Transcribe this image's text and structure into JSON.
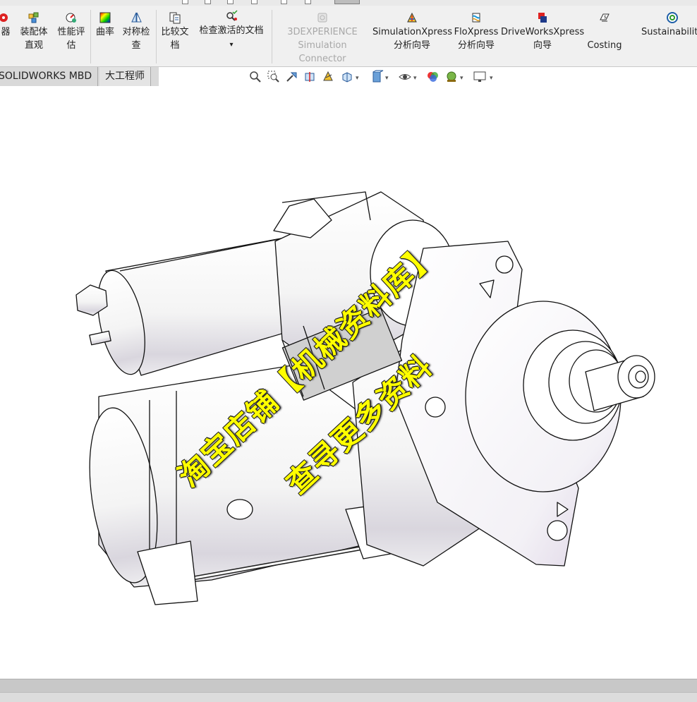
{
  "ribbon": {
    "tools": [
      {
        "id": "partial-left",
        "label": "器",
        "icon": "partial-tool-icon"
      },
      {
        "id": "assembly-visualization",
        "label_l1": "装配体",
        "label_l2": "直观",
        "icon": "assembly-visualization-icon"
      },
      {
        "id": "performance-evaluation",
        "label_l1": "性能评",
        "label_l2": "估",
        "icon": "performance-evaluation-icon"
      },
      {
        "id": "curvature",
        "label_l1": "曲率",
        "label_l2": "",
        "icon": "curvature-icon"
      },
      {
        "id": "symmetry-check",
        "label_l1": "对称检",
        "label_l2": "查",
        "icon": "symmetry-check-icon"
      },
      {
        "id": "compare-documents",
        "label_l1": "比较文",
        "label_l2": "档",
        "icon": "compare-documents-icon"
      },
      {
        "id": "check-active-document",
        "label_l1": "检查激活的文档",
        "label_l2": "▾",
        "icon": "check-active-document-icon"
      },
      {
        "id": "simulation-connector",
        "label_l1": "3DEXPERIENCE",
        "label_l2": "Simulation Connector",
        "icon": "3dexperience-icon",
        "disabled": true
      },
      {
        "id": "simulationxpress",
        "label_l1": "SimulationXpress",
        "label_l2": "分析向导",
        "icon": "simulationxpress-icon"
      },
      {
        "id": "floxpress",
        "label_l1": "FloXpress",
        "label_l2": "分析向导",
        "icon": "floxpress-icon"
      },
      {
        "id": "driveworksxpress",
        "label_l1": "DriveWorksXpress",
        "label_l2": "向导",
        "icon": "driveworksxpress-icon"
      },
      {
        "id": "costing",
        "label_l1": "",
        "label_l2": "Costing",
        "icon": "costing-icon"
      },
      {
        "id": "sustainability",
        "label_l1": "Sustainability",
        "label_l2": "",
        "icon": "sustainability-icon"
      }
    ]
  },
  "tabs": [
    {
      "label": "SOLIDWORKS MBD"
    },
    {
      "label": "大工程师"
    }
  ],
  "heads_up": {
    "icons": [
      "zoom-to-fit-icon",
      "zoom-to-area-icon",
      "previous-view-icon",
      "section-view-icon",
      "dynamic-annotation-icon",
      "view-orientation-icon",
      "display-style-icon",
      "hide-show-items-icon",
      "edit-appearance-icon",
      "apply-scene-icon",
      "view-settings-icon"
    ]
  },
  "watermark": {
    "line1": "淘宝店铺【机械资料库】",
    "line2": "查寻更多资料"
  },
  "colors": {
    "ribbon_bg": "#f0f0f0",
    "tab_bg": "#d9d9d9",
    "watermark": "#ffff00",
    "disabled_text": "#a8a8a8"
  }
}
